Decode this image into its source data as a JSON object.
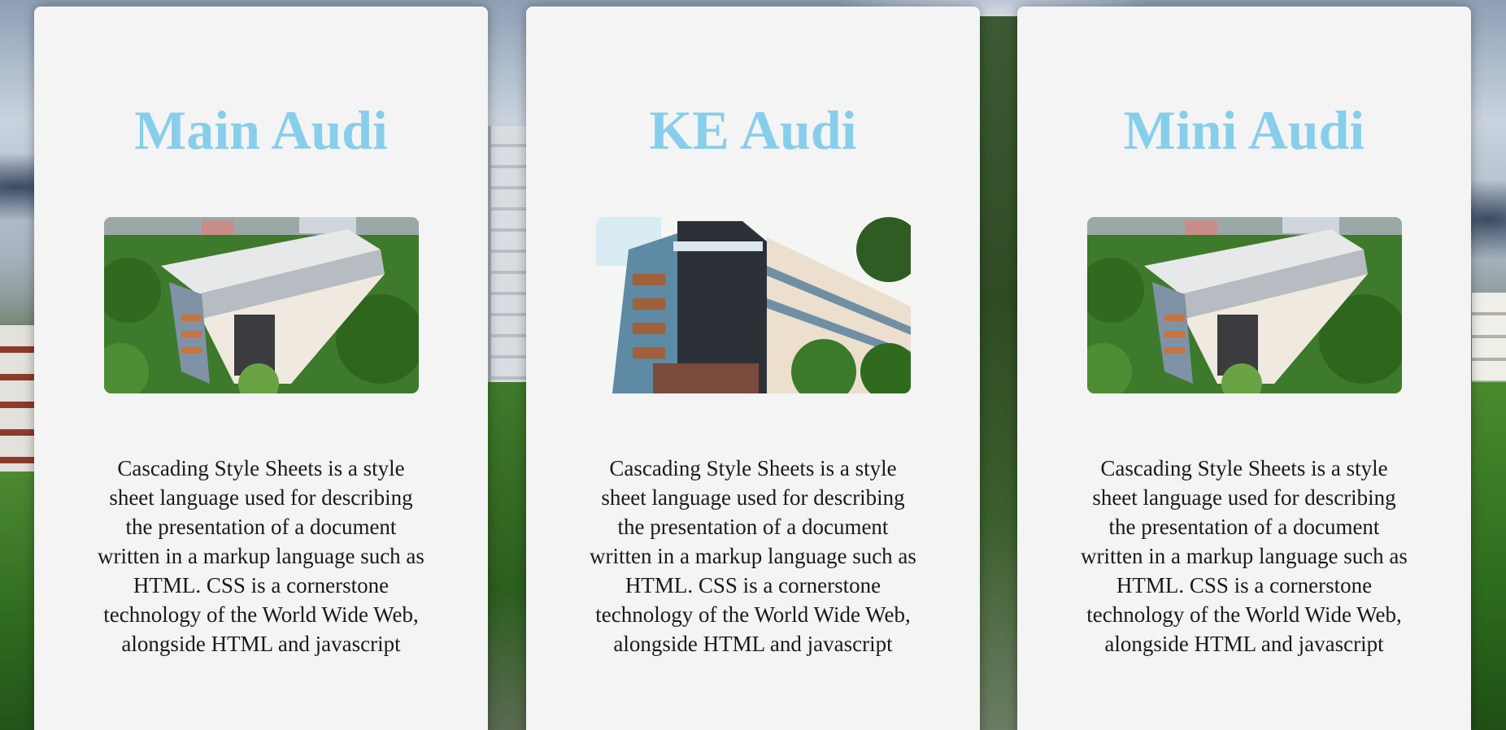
{
  "colors": {
    "title": "#87ceeb",
    "card_background": "#f4f4f4",
    "body_text": "#1a1a1a"
  },
  "cards": [
    {
      "title": "Main Audi",
      "image": "aerial-building-photo",
      "description": "Cascading Style Sheets is a style sheet language used for describing the presentation of a document written in a markup language such as HTML. CSS is a cornerstone technology of the World Wide Web, alongside HTML and javascript"
    },
    {
      "title": "KE Audi",
      "image": "university-building-photo",
      "description": "Cascading Style Sheets is a style sheet language used for describing the presentation of a document written in a markup language such as HTML. CSS is a cornerstone technology of the World Wide Web, alongside HTML and javascript"
    },
    {
      "title": "Mini Audi",
      "image": "aerial-building-photo",
      "description": "Cascading Style Sheets is a style sheet language used for describing the presentation of a document written in a markup language such as HTML. CSS is a cornerstone technology of the World Wide Web, alongside HTML and javascript"
    }
  ]
}
